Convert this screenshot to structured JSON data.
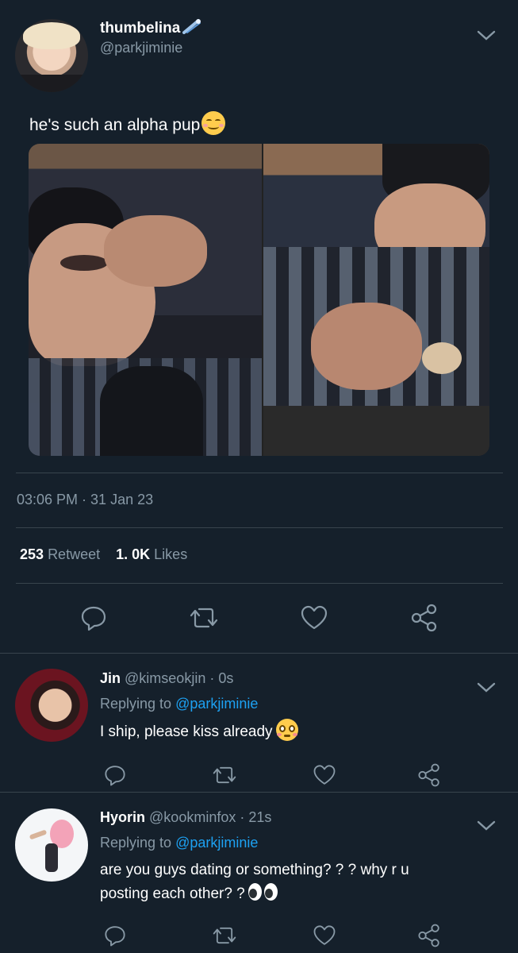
{
  "main_tweet": {
    "display_name": "thumbelina",
    "handle": "@parkjiminie",
    "text": "he's such an alpha pup",
    "timestamp": "03:06 PM · 31 Jan 23",
    "retweets_count": "253",
    "retweets_label": "Retweet",
    "likes_count": "1. 0K",
    "likes_label": "Likes",
    "icons": [
      "reply-icon",
      "retweet-icon",
      "like-icon",
      "share-icon"
    ]
  },
  "replies": [
    {
      "display_name": "Jin",
      "handle": "@kimseokjin",
      "time": "· 0s",
      "replying_label": "Replying to",
      "replying_to": "@parkjiminie",
      "text": "I ship,  please kiss already"
    },
    {
      "display_name": "Hyorin",
      "handle": "@kookminfox",
      "time": "· 21s",
      "replying_label": "Replying to",
      "replying_to": "@parkjiminie",
      "text_line1": "are you guys dating or something? ? ?  why r u",
      "text_line2": "posting each other? ?"
    }
  ],
  "colors": {
    "background": "#15202b",
    "muted": "#8899a6",
    "accent": "#1da1f2",
    "divider": "#38444d"
  }
}
